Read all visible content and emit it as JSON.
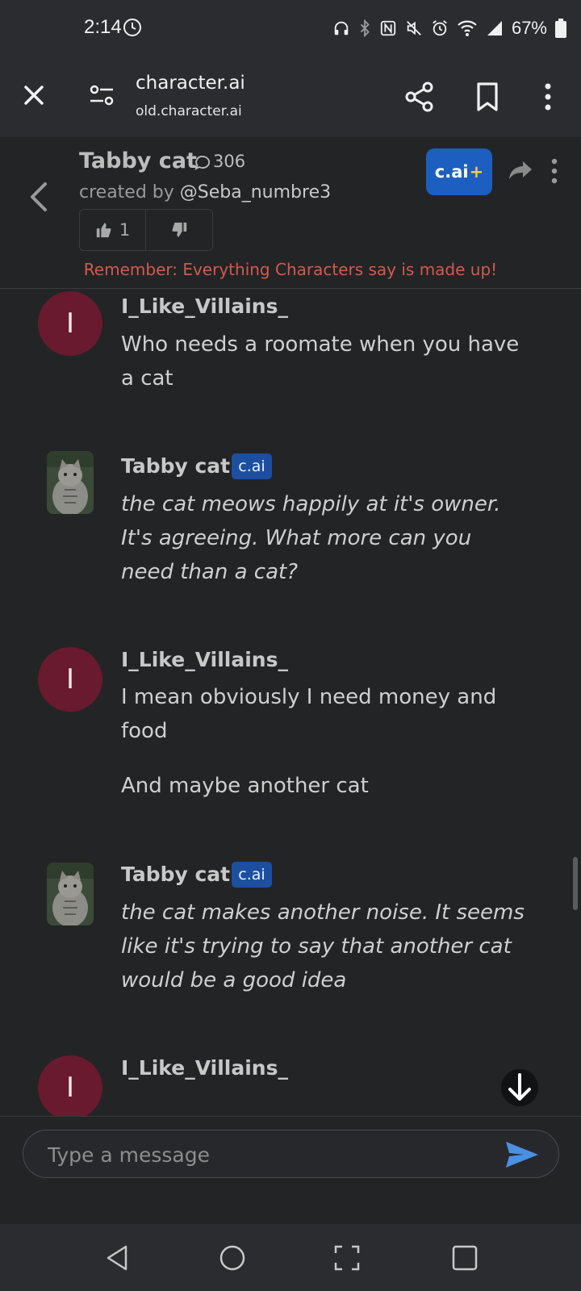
{
  "status_bar": {
    "time": "2:14",
    "battery": "67%"
  },
  "browser": {
    "title": "character.ai",
    "url": "old.character.ai"
  },
  "character": {
    "name": "Tabby cat",
    "chat_count": "306",
    "created_by_prefix": "created by ",
    "creator": "@Seba_numbre3",
    "likes": "1",
    "plus_label": "c.ai",
    "plus_symbol": "+",
    "disclaimer": "Remember: Everything Characters say is made up!"
  },
  "messages": [
    {
      "author": "I_Like_Villains_",
      "avatar_letter": "I",
      "paragraphs": [
        "Who needs a roomate when you have a cat"
      ]
    },
    {
      "author": "Tabby cat",
      "tag": "c.ai",
      "paragraphs": [
        "the cat meows happily at it's owner. It's agreeing. What more can you need than a cat?"
      ]
    },
    {
      "author": "I_Like_Villains_",
      "avatar_letter": "I",
      "paragraphs": [
        "I mean obviously I need money and food",
        "And maybe another cat"
      ]
    },
    {
      "author": "Tabby cat",
      "tag": "c.ai",
      "paragraphs": [
        "the cat makes another noise. It seems like it's trying to say that another cat would be a good idea"
      ]
    },
    {
      "author": "I_Like_Villains_",
      "avatar_letter": "I",
      "paragraphs": []
    }
  ],
  "input": {
    "placeholder": "Type a message"
  },
  "colors": {
    "background": "#232425",
    "user_avatar": "#6a1a2e",
    "accent_blue": "#1d5fc0",
    "disclaimer": "#d25a4f",
    "send": "#4a90e2"
  }
}
